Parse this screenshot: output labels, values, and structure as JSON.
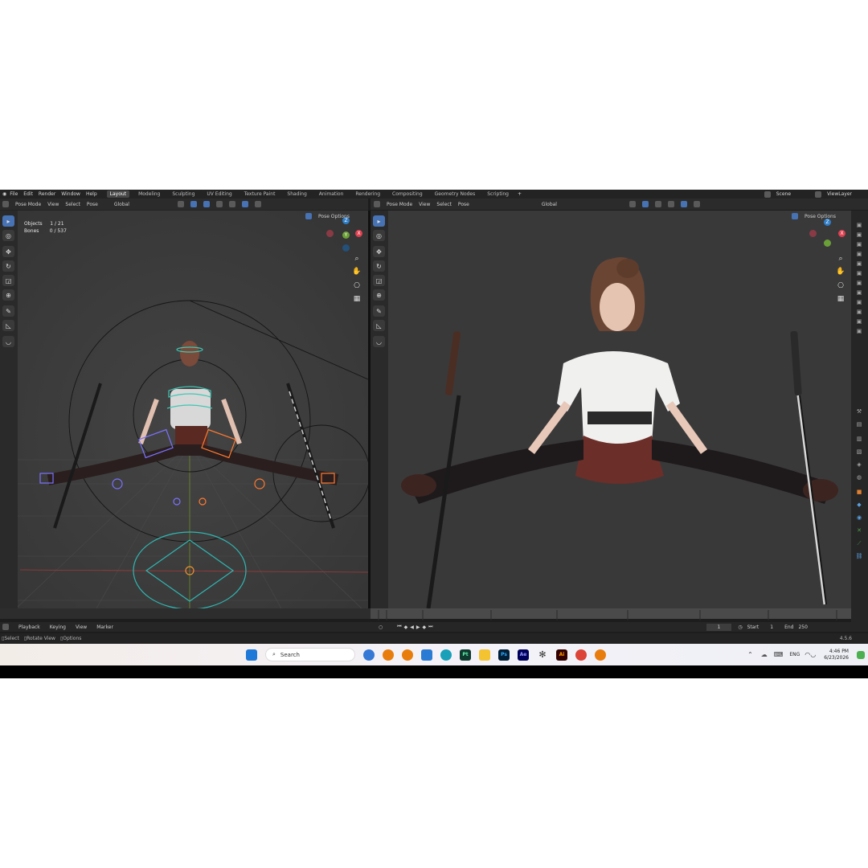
{
  "menu": {
    "items": [
      "File",
      "Edit",
      "Render",
      "Window",
      "Help"
    ],
    "workspaces": [
      "Layout",
      "Modeling",
      "Sculpting",
      "UV Editing",
      "Texture Paint",
      "Shading",
      "Animation",
      "Rendering",
      "Compositing",
      "Geometry Nodes",
      "Scripting"
    ],
    "active_workspace": "Layout",
    "add_tab": "+",
    "scene_label": "Scene",
    "viewlayer_label": "ViewLayer"
  },
  "left_view": {
    "mode": "Pose Mode",
    "menus": [
      "View",
      "Select",
      "Pose"
    ],
    "orientation": "Global",
    "pose_options": "Pose Options",
    "stats": {
      "objects_label": "Objects",
      "objects_value": "1 / 21",
      "bones_label": "Bones",
      "bones_value": "0 / 537"
    }
  },
  "right_view": {
    "mode": "Pose Mode",
    "menus": [
      "View",
      "Select",
      "Pose"
    ],
    "orientation": "Global",
    "pose_options": "Pose Options"
  },
  "gizmo": {
    "z_label": "Z",
    "x_label": "X",
    "y_label": "Y"
  },
  "timeline": {
    "menus": [
      "Playback",
      "Keying",
      "View",
      "Marker"
    ],
    "current_frame": "1",
    "start_label": "Start",
    "start_value": "1",
    "end_label": "End",
    "end_value": "250"
  },
  "status": {
    "select": "Select",
    "rotate": "Rotate View",
    "options": "Options",
    "version": "4.5.6"
  },
  "taskbar": {
    "search_placeholder": "Search",
    "language": "ENG",
    "time": "4:46 PM",
    "date": "6/23/2026",
    "app_labels": [
      "Pt",
      "Ps",
      "Ae",
      "Ai"
    ]
  },
  "colors": {
    "blender_blue": "#4772b3",
    "axis_x": "#e04050",
    "axis_y": "#6ba037",
    "axis_z": "#2f7ec9"
  }
}
